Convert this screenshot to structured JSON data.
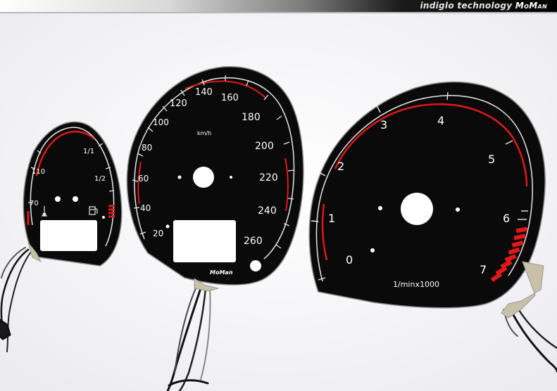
{
  "banner": {
    "text": "indiglo technology",
    "brand": "MoMan"
  },
  "colors": {
    "dial_face": "#0a0a0a",
    "scale_line": "#e8e8e8",
    "redline": "#e01818",
    "background": "#f4f4f6",
    "window": "#ffffff"
  },
  "left_gauge": {
    "labels": [
      "70",
      "110",
      "1/1",
      "1/2"
    ],
    "icons": [
      "thermometer-icon",
      "fuel-pump-icon"
    ]
  },
  "speedometer": {
    "unit": "km/h",
    "labels": [
      "20",
      "40",
      "60",
      "80",
      "100",
      "120",
      "140",
      "160",
      "180",
      "200",
      "220",
      "240",
      "260"
    ],
    "brand": "MoMan"
  },
  "tachometer": {
    "unit": "1/minx1000",
    "labels": [
      "0",
      "1",
      "2",
      "3",
      "4",
      "5",
      "6",
      "7"
    ]
  }
}
